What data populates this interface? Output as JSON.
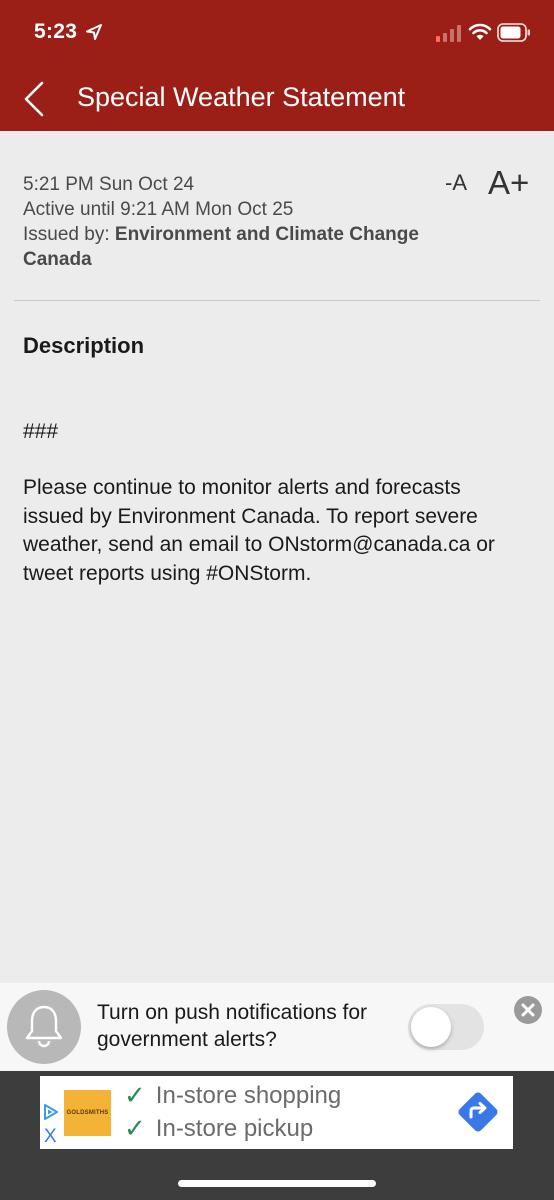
{
  "status_bar": {
    "time": "5:23"
  },
  "nav": {
    "title": "Special Weather Statement"
  },
  "meta": {
    "issued_time": "5:21 PM Sun Oct 24",
    "active_until": "Active until 9:21 AM Mon Oct 25",
    "issued_by_label": "Issued by: ",
    "issued_by": "Environment and Climate Change Canada"
  },
  "font_controls": {
    "decrease_label": "-A",
    "increase_label": "A+"
  },
  "description": {
    "heading": "Description",
    "marker": "###",
    "body": "Please continue to monitor alerts and forecasts issued by Environment Canada. To report severe weather, send an email to ONstorm@canada.ca or tweet reports using #ONStorm."
  },
  "push_banner": {
    "text": "Turn on push notifications for government alerts?",
    "toggle_on": false
  },
  "ad": {
    "logo_text": "GOLDSMITHS",
    "line1": "In-store shopping",
    "line2": "In-store pickup",
    "close_glyph": "X"
  },
  "colors": {
    "header": "#9c1f17",
    "background": "#ececec",
    "accent_check": "#2f8a56",
    "ad_direction": "#3b78e7"
  },
  "icons": [
    "location-arrow-icon",
    "signal-icon",
    "wifi-icon",
    "battery-icon",
    "back-chevron-icon",
    "bell-icon",
    "close-icon",
    "ad-choices-icon",
    "check-icon",
    "directions-icon"
  ]
}
